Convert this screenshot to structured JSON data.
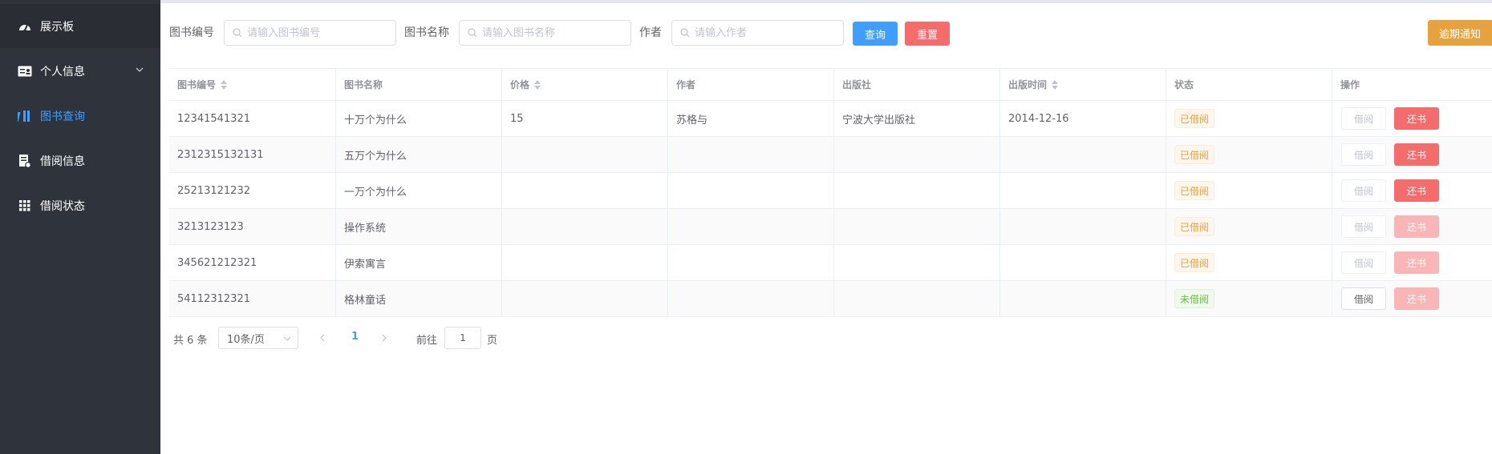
{
  "sidebar": {
    "items": [
      {
        "label": "展示板",
        "icon": "dashboard-icon"
      },
      {
        "label": "个人信息",
        "icon": "id-card-icon"
      },
      {
        "label": "图书查询",
        "icon": "books-icon"
      },
      {
        "label": "借阅信息",
        "icon": "document-icon"
      },
      {
        "label": "借阅状态",
        "icon": "grid-icon"
      }
    ]
  },
  "search": {
    "book_id_label": "图书编号",
    "book_id_placeholder": "请输入图书编号",
    "book_name_label": "图书名称",
    "book_name_placeholder": "请输入图书名称",
    "author_label": "作者",
    "author_placeholder": "请输入作者",
    "query_label": "查询",
    "reset_label": "重置"
  },
  "overdue_label": "逾期通知",
  "colors": {
    "primary": "#409eff",
    "danger": "#f56c6c",
    "warning": "#e6a23c",
    "sidebar": "#2f333b"
  },
  "table": {
    "columns": [
      "图书编号",
      "图书名称",
      "价格",
      "作者",
      "出版社",
      "出版时间",
      "状态",
      "操作"
    ],
    "rows": [
      {
        "id": "12341541321",
        "name": "十万个为什么",
        "price": "15",
        "author": "苏格与",
        "publisher": "宁波大学出版社",
        "date": "2014-12-16",
        "status": "已借阅",
        "borrow": "借阅",
        "return": "还书"
      },
      {
        "id": "2312315132131",
        "name": "五万个为什么",
        "price": "",
        "author": "",
        "publisher": "",
        "date": "",
        "status": "已借阅",
        "borrow": "借阅",
        "return": "还书"
      },
      {
        "id": "25213121232",
        "name": "一万个为什么",
        "price": "",
        "author": "",
        "publisher": "",
        "date": "",
        "status": "已借阅",
        "borrow": "借阅",
        "return": "还书"
      },
      {
        "id": "3213123123",
        "name": "操作系统",
        "price": "",
        "author": "",
        "publisher": "",
        "date": "",
        "status": "已借阅",
        "borrow": "借阅",
        "return": "还书"
      },
      {
        "id": "345621212321",
        "name": "伊索寓言",
        "price": "",
        "author": "",
        "publisher": "",
        "date": "",
        "status": "已借阅",
        "borrow": "借阅",
        "return": "还书"
      },
      {
        "id": "54112312321",
        "name": "格林童话",
        "price": "",
        "author": "",
        "publisher": "",
        "date": "",
        "status": "未借阅",
        "borrow": "借阅",
        "return": "还书"
      }
    ]
  },
  "pagination": {
    "total_text": "共 6 条",
    "page_size": "10条/页",
    "current_page": "1",
    "goto_label": "前往",
    "goto_value": "1",
    "page_unit": "页"
  }
}
